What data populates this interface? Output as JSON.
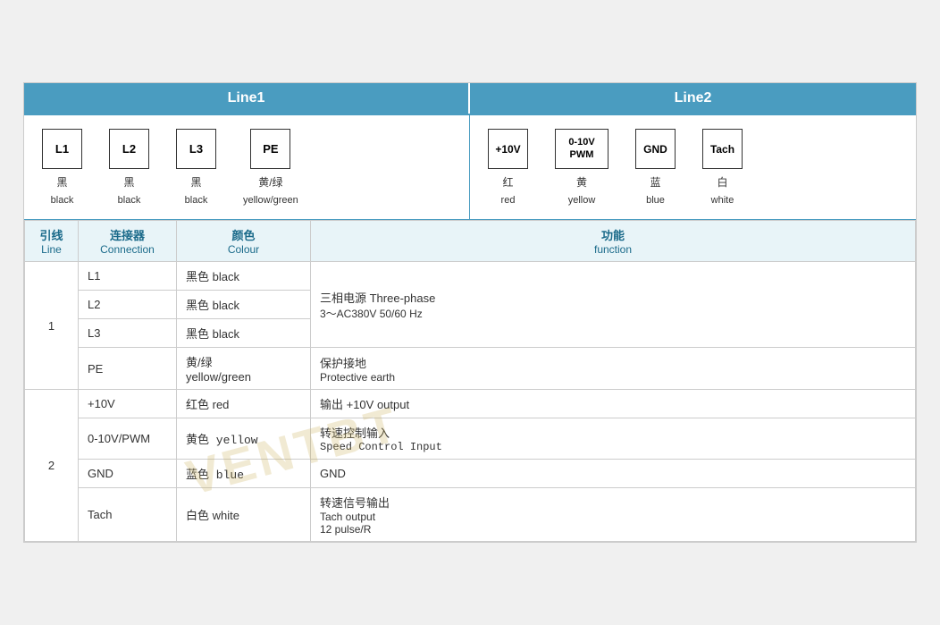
{
  "header": {
    "line1_label": "Line1",
    "line2_label": "Line2"
  },
  "line1_connectors": [
    {
      "id": "conn-l1",
      "box_label": "L1",
      "cn": "黑",
      "en": "black"
    },
    {
      "id": "conn-l2",
      "box_label": "L2",
      "cn": "黑",
      "en": "black"
    },
    {
      "id": "conn-l3",
      "box_label": "L3",
      "cn": "黑",
      "en": "black"
    },
    {
      "id": "conn-pe",
      "box_label": "PE",
      "cn": "黄/绿",
      "en": "yellow/green"
    }
  ],
  "line2_connectors": [
    {
      "id": "conn-10v",
      "box_label": "+10V",
      "cn": "红",
      "en": "red"
    },
    {
      "id": "conn-pwm",
      "box_label": "0-10V\nPWM",
      "cn": "黄",
      "en": "yellow"
    },
    {
      "id": "conn-gnd",
      "box_label": "GND",
      "cn": "蓝",
      "en": "blue"
    },
    {
      "id": "conn-tach",
      "box_label": "Tach",
      "cn": "白",
      "en": "white"
    }
  ],
  "table": {
    "col_headers": [
      {
        "cn": "引线",
        "en": "Line"
      },
      {
        "cn": "连接器",
        "en": "Connection"
      },
      {
        "cn": "颜色",
        "en": "Colour"
      },
      {
        "cn": "功能",
        "en": "function"
      }
    ],
    "rows": [
      {
        "line": "1",
        "rowspan": 4,
        "entries": [
          {
            "connection": "L1",
            "colour_cn": "黑色 black",
            "func_cn": "三相电源 Three-phase",
            "func_en": "3～AC380V 50/60 Hz",
            "func_en2": "",
            "func_rowspan": 3
          },
          {
            "connection": "L2",
            "colour_cn": "黑色 black",
            "func_cn": "",
            "func_en": "",
            "func_en2": "",
            "func_rowspan": 0
          },
          {
            "connection": "L3",
            "colour_cn": "黑色 black",
            "func_cn": "",
            "func_en": "",
            "func_en2": "",
            "func_rowspan": 0
          },
          {
            "connection": "PE",
            "colour_cn": "黄/绿\nyellow/green",
            "func_cn": "保护接地",
            "func_en": "Protective earth",
            "func_en2": "",
            "func_rowspan": 1
          }
        ]
      },
      {
        "line": "2",
        "rowspan": 4,
        "entries": [
          {
            "connection": "+10V",
            "colour_cn": "红色 red",
            "func_cn": "输出 +10V output",
            "func_en": "",
            "func_en2": "",
            "func_rowspan": 1
          },
          {
            "connection": "0-10V/PWM",
            "colour_cn": "黄色 yellow",
            "func_cn": "转速控制输入",
            "func_en": "Speed Control Input",
            "func_en2": "",
            "func_rowspan": 1
          },
          {
            "connection": "GND",
            "colour_cn": "蓝色 blue",
            "func_cn": "GND",
            "func_en": "",
            "func_en2": "",
            "func_rowspan": 1
          },
          {
            "connection": "Tach",
            "colour_cn": "白色 white",
            "func_cn": "转速信号输出",
            "func_en": "Tach output",
            "func_en2": "12 pulse/R",
            "func_rowspan": 1
          }
        ]
      }
    ]
  },
  "watermark": "VENTBT"
}
